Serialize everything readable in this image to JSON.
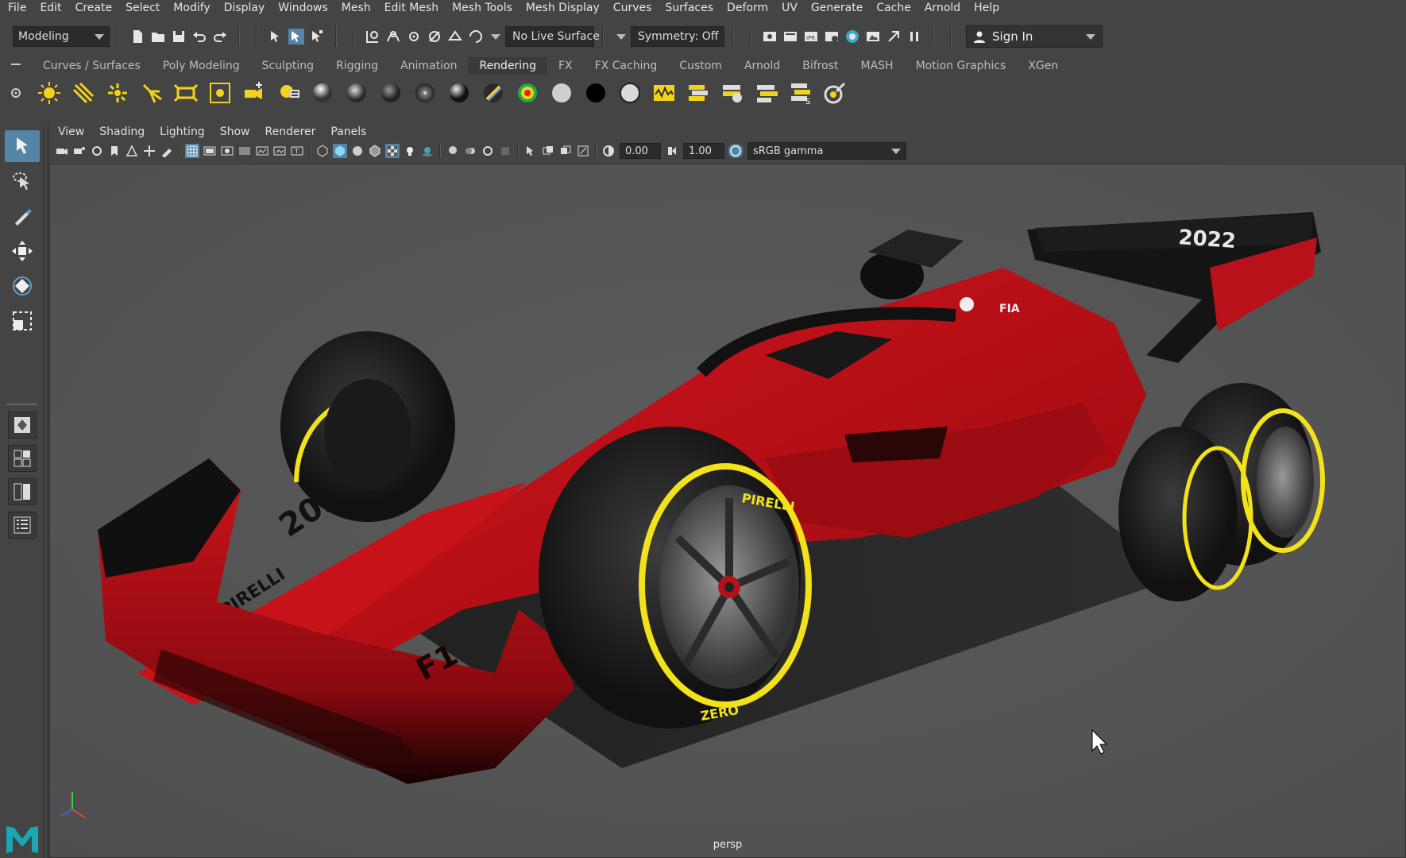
{
  "menubar": [
    "File",
    "Edit",
    "Create",
    "Select",
    "Modify",
    "Display",
    "Windows",
    "Mesh",
    "Edit Mesh",
    "Mesh Tools",
    "Mesh Display",
    "Curves",
    "Surfaces",
    "Deform",
    "UV",
    "Generate",
    "Cache",
    "Arnold",
    "Help"
  ],
  "statusline": {
    "mode": "Modeling",
    "live_surface": "No Live Surface",
    "symmetry": "Symmetry: Off",
    "sign_in": "Sign In"
  },
  "shelf": {
    "tabs": [
      "Curves / Surfaces",
      "Poly Modeling",
      "Sculpting",
      "Rigging",
      "Animation",
      "Rendering",
      "FX",
      "FX Caching",
      "Custom",
      "Arnold",
      "Bifrost",
      "MASH",
      "Motion Graphics",
      "XGen"
    ],
    "active_tab": "Rendering"
  },
  "panel": {
    "menu": [
      "View",
      "Shading",
      "Lighting",
      "Show",
      "Renderer",
      "Panels"
    ],
    "exposure": "0.00",
    "gamma_value": "1.00",
    "color_space": "sRGB gamma",
    "camera": "persp"
  },
  "colors": {
    "accent": "#5285a6",
    "car_red": "#c1121a",
    "tyre_stripe": "#f2e21a"
  }
}
